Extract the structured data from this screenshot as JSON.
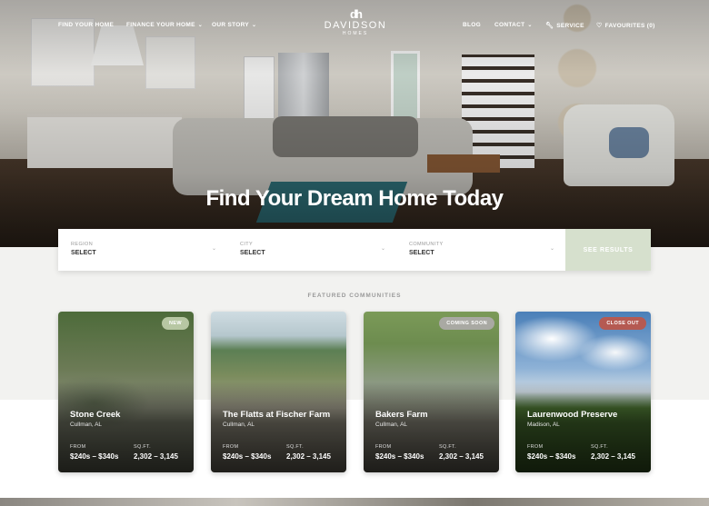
{
  "nav": {
    "find_home": "FIND YOUR HOME",
    "finance_home": "FINANCE YOUR HOME",
    "our_story": "OUR STORY",
    "blog": "BLOG",
    "contact": "CONTACT",
    "service": "SERVICE",
    "favourites": "FAVOURITES (0)"
  },
  "logo": {
    "name": "DAVIDSON",
    "sub": "HOMES",
    "mark": "dh"
  },
  "hero": {
    "title": "Find Your Dream Home Today"
  },
  "search": {
    "fields": [
      {
        "label": "REGION",
        "value": "SELECT"
      },
      {
        "label": "CITY",
        "value": "SELECT"
      },
      {
        "label": "COMMUNITY",
        "value": "SELECT"
      }
    ],
    "button": "SEE RESULTS"
  },
  "featured_heading": "FEATURED COMMUNITIES",
  "communities": [
    {
      "name": "Stone Creek",
      "location": "Cullman, AL",
      "badge": "NEW",
      "badge_color": "#b7c7a3",
      "from_label": "FROM",
      "from_value": "$240s – $340s",
      "sqft_label": "SQ.FT.",
      "sqft_value": "2,302 – 3,145"
    },
    {
      "name": "The Flatts at Fischer Farm",
      "location": "Cullman, AL",
      "badge": "",
      "badge_color": "",
      "from_label": "FROM",
      "from_value": "$240s – $340s",
      "sqft_label": "SQ.FT.",
      "sqft_value": "2,302 – 3,145"
    },
    {
      "name": "Bakers Farm",
      "location": "Cullman, AL",
      "badge": "COMING SOON",
      "badge_color": "#a9a9a3",
      "from_label": "FROM",
      "from_value": "$240s – $340s",
      "sqft_label": "SQ.FT.",
      "sqft_value": "2,302 – 3,145"
    },
    {
      "name": "Laurenwood Preserve",
      "location": "Madison, AL",
      "badge": "CLOSE OUT",
      "badge_color": "#b55a52",
      "from_label": "FROM",
      "from_value": "$240s – $340s",
      "sqft_label": "SQ.FT.",
      "sqft_value": "2,302 – 3,145"
    }
  ]
}
